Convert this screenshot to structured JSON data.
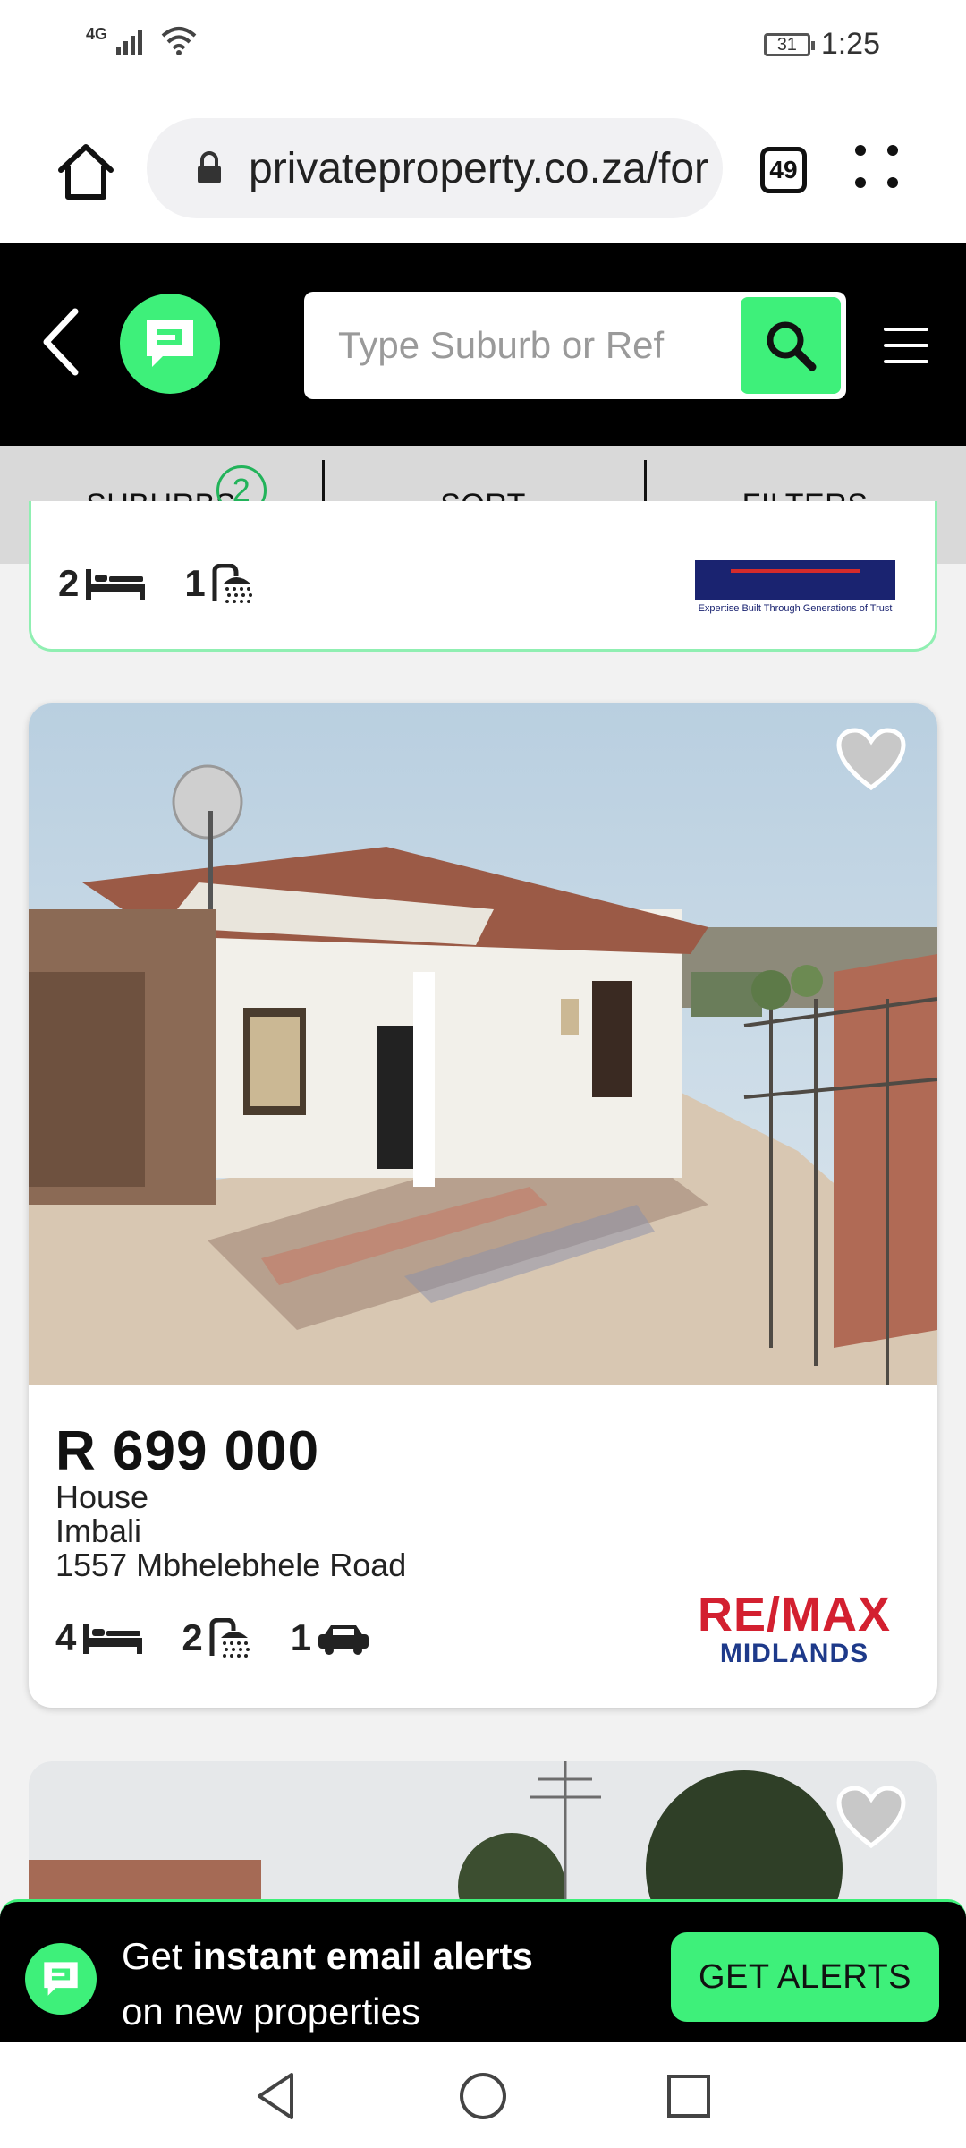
{
  "status_bar": {
    "network": "4G",
    "battery": "31",
    "time": "1:25"
  },
  "browser": {
    "url": "privateproperty.co.za/for",
    "tab_count": "49"
  },
  "site_header": {
    "search_placeholder": "Type Suburb or Ref"
  },
  "filter_bar": {
    "suburbs_label": "SUBURBS",
    "suburbs_count": "2",
    "sort_label": "SORT",
    "filters_label": "FILTERS"
  },
  "previous_listing": {
    "bedrooms": "2",
    "bathrooms": "1",
    "agency_tagline": "Expertise Built Through Generations of Trust"
  },
  "listing": {
    "price": "R 699 000",
    "type": "House",
    "suburb": "Imbali",
    "address": "1557 Mbhelebhele Road",
    "bedrooms": "4",
    "bathrooms": "2",
    "parking": "1",
    "agency_top": "RE/MAX",
    "agency_bottom": "MIDLANDS"
  },
  "alert_banner": {
    "text_prefix": "Get ",
    "text_bold": "instant email alerts",
    "text_line2": "on new properties",
    "button_label": "GET ALERTS"
  },
  "colors": {
    "brand_green": "#3ef07a",
    "header_black": "#000000",
    "remax_red": "#d32030",
    "remax_blue": "#1e3a8a"
  }
}
